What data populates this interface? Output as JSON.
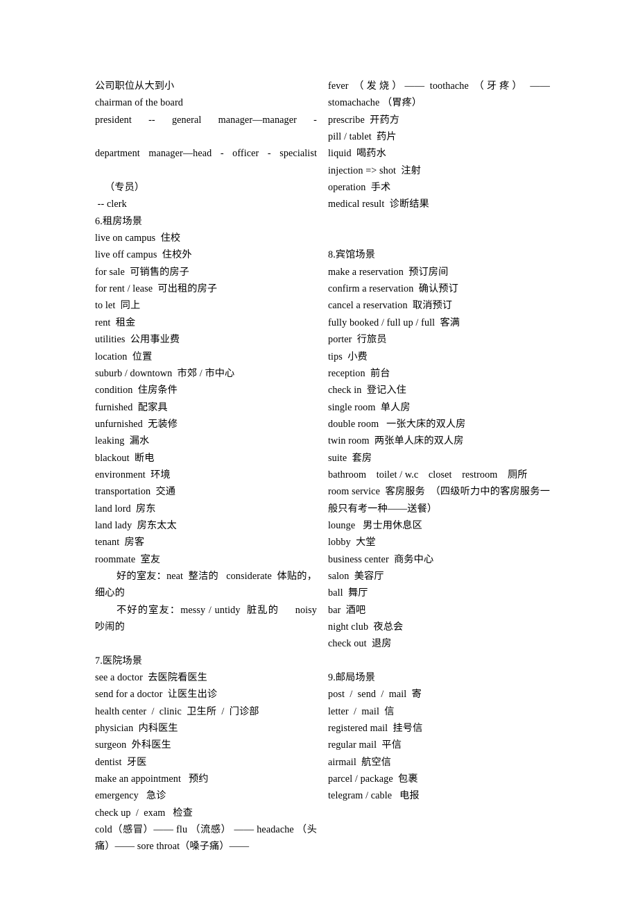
{
  "document": {
    "type": "vocabulary-study-notes",
    "language": "Chinese-English",
    "columns": 2
  },
  "left_column": {
    "lines": [
      {
        "id": "l1",
        "text": "公司职位从大到小",
        "style": "normal"
      },
      {
        "id": "l2",
        "text": "chairman of the board",
        "style": "normal"
      },
      {
        "id": "l3",
        "text": "president  --  general  manager—manager  -",
        "style": "stretch"
      },
      {
        "id": "l4",
        "text": "department manager—head - officer - specialist",
        "style": "stretch"
      },
      {
        "id": "l5",
        "text": "（专员）",
        "style": "indent2"
      },
      {
        "id": "l6",
        "text": " -- clerk",
        "style": "normal"
      },
      {
        "id": "l7",
        "text": "6.租房场景",
        "style": "normal"
      },
      {
        "id": "l8",
        "text": "live on campus  住校",
        "style": "normal"
      },
      {
        "id": "l9",
        "text": "live off campus  住校外",
        "style": "normal"
      },
      {
        "id": "l10",
        "text": "for sale  可销售的房子",
        "style": "normal"
      },
      {
        "id": "l11",
        "text": "for rent / lease  可出租的房子",
        "style": "normal"
      },
      {
        "id": "l12",
        "text": "to let  同上",
        "style": "normal"
      },
      {
        "id": "l13",
        "text": "rent  租金",
        "style": "normal"
      },
      {
        "id": "l14",
        "text": "utilities  公用事业费",
        "style": "normal"
      },
      {
        "id": "l15",
        "text": "location  位置",
        "style": "normal"
      },
      {
        "id": "l16",
        "text": "suburb / downtown  市郊 / 市中心",
        "style": "normal"
      },
      {
        "id": "l17",
        "text": "condition  住房条件",
        "style": "normal"
      },
      {
        "id": "l18",
        "text": "furnished  配家具",
        "style": "normal"
      },
      {
        "id": "l19",
        "text": "unfurnished  无装修",
        "style": "normal"
      },
      {
        "id": "l20",
        "text": "leaking  漏水",
        "style": "normal"
      },
      {
        "id": "l21",
        "text": "blackout  断电",
        "style": "normal"
      },
      {
        "id": "l22",
        "text": "environment  环境",
        "style": "normal"
      },
      {
        "id": "l23",
        "text": "transportation  交通",
        "style": "normal"
      },
      {
        "id": "l24",
        "text": "land lord  房东",
        "style": "normal"
      },
      {
        "id": "l25",
        "text": "land lady  房东太太",
        "style": "normal"
      },
      {
        "id": "l26",
        "text": "tenant  房客",
        "style": "normal"
      },
      {
        "id": "l27",
        "text": "roommate  室友",
        "style": "normal"
      },
      {
        "id": "l28",
        "text": "好的室友：neat  整洁的   considerate  体贴的，细心的",
        "style": "indent"
      },
      {
        "id": "l29",
        "text": "不好的室友：messy / untidy  脏乱的     noisy  吵闹的",
        "style": "indent"
      },
      {
        "id": "l30",
        "text": "",
        "style": "blank"
      },
      {
        "id": "l31",
        "text": "7.医院场景",
        "style": "normal"
      },
      {
        "id": "l32",
        "text": "see a doctor  去医院看医生",
        "style": "normal"
      },
      {
        "id": "l33",
        "text": "send for a doctor  让医生出诊",
        "style": "normal"
      },
      {
        "id": "l34",
        "text": "health center  /  clinic  卫生所  /  门诊部",
        "style": "normal"
      },
      {
        "id": "l35",
        "text": "physician  内科医生",
        "style": "normal"
      },
      {
        "id": "l36",
        "text": "surgeon  外科医生",
        "style": "normal"
      },
      {
        "id": "l37",
        "text": "dentist  牙医",
        "style": "normal"
      },
      {
        "id": "l38",
        "text": "make an appointment   预约",
        "style": "normal"
      },
      {
        "id": "l39",
        "text": "emergency   急诊",
        "style": "normal"
      },
      {
        "id": "l40",
        "text": "check up  /  exam   检查",
        "style": "normal"
      },
      {
        "id": "l41",
        "text": "cold（感冒）—— flu （流感） —— headache （头痛）—— sore throat（嗓子痛）——",
        "style": "normal"
      }
    ]
  },
  "right_column": {
    "lines": [
      {
        "id": "r1",
        "text": "fever （发烧）—— toothache （牙疼） —— stomachache （胃疼）",
        "style": "normal"
      },
      {
        "id": "r2",
        "text": "prescribe  开药方",
        "style": "normal"
      },
      {
        "id": "r3",
        "text": "pill / tablet  药片",
        "style": "normal"
      },
      {
        "id": "r4",
        "text": "liquid  喝药水",
        "style": "normal"
      },
      {
        "id": "r5",
        "text": "injection => shot  注射",
        "style": "normal"
      },
      {
        "id": "r6",
        "text": "operation  手术",
        "style": "normal"
      },
      {
        "id": "r7",
        "text": "medical result  诊断结果",
        "style": "normal"
      },
      {
        "id": "r8",
        "text": "",
        "style": "blank"
      },
      {
        "id": "r9",
        "text": "",
        "style": "blank"
      },
      {
        "id": "r10",
        "text": "8.宾馆场景",
        "style": "normal"
      },
      {
        "id": "r11",
        "text": "make a reservation  预订房间",
        "style": "normal"
      },
      {
        "id": "r12",
        "text": "confirm a reservation  确认预订",
        "style": "normal"
      },
      {
        "id": "r13",
        "text": "cancel a reservation  取消预订",
        "style": "normal"
      },
      {
        "id": "r14",
        "text": "fully booked / full up / full  客满",
        "style": "normal"
      },
      {
        "id": "r15",
        "text": "porter  行旅员",
        "style": "normal"
      },
      {
        "id": "r16",
        "text": "tips  小费",
        "style": "normal"
      },
      {
        "id": "r17",
        "text": "reception  前台",
        "style": "normal"
      },
      {
        "id": "r18",
        "text": "check in  登记入住",
        "style": "normal"
      },
      {
        "id": "r19",
        "text": "single room  单人房",
        "style": "normal"
      },
      {
        "id": "r20",
        "text": "double room   一张大床的双人房",
        "style": "normal"
      },
      {
        "id": "r21",
        "text": "twin room  两张单人床的双人房",
        "style": "normal"
      },
      {
        "id": "r22",
        "text": "suite  套房",
        "style": "normal"
      },
      {
        "id": "r23",
        "text": "bathroom    toilet / w.c    closet    restroom    厕所",
        "style": "normal"
      },
      {
        "id": "r24",
        "text": "room service  客房服务  （四级听力中的客房服务一般只有考一种——送餐）",
        "style": "normal"
      },
      {
        "id": "r25",
        "text": "lounge   男士用休息区",
        "style": "normal"
      },
      {
        "id": "r26",
        "text": "lobby  大堂",
        "style": "normal"
      },
      {
        "id": "r27",
        "text": "business center  商务中心",
        "style": "normal"
      },
      {
        "id": "r28",
        "text": "salon  美容厅",
        "style": "normal"
      },
      {
        "id": "r29",
        "text": "ball  舞厅",
        "style": "normal"
      },
      {
        "id": "r30",
        "text": "bar  酒吧",
        "style": "normal"
      },
      {
        "id": "r31",
        "text": "night club  夜总会",
        "style": "normal"
      },
      {
        "id": "r32",
        "text": "check out  退房",
        "style": "normal"
      },
      {
        "id": "r33",
        "text": "",
        "style": "blank"
      },
      {
        "id": "r34",
        "text": "9.邮局场景",
        "style": "normal"
      },
      {
        "id": "r35",
        "text": "post  /  send  /  mail  寄",
        "style": "normal"
      },
      {
        "id": "r36",
        "text": "letter  /  mail  信",
        "style": "normal"
      },
      {
        "id": "r37",
        "text": "registered mail  挂号信",
        "style": "normal"
      },
      {
        "id": "r38",
        "text": "regular mail  平信",
        "style": "normal"
      },
      {
        "id": "r39",
        "text": "airmail  航空信",
        "style": "normal"
      },
      {
        "id": "r40",
        "text": "parcel / package  包裹",
        "style": "normal"
      },
      {
        "id": "r41",
        "text": "telegram / cable   电报",
        "style": "normal"
      }
    ]
  }
}
